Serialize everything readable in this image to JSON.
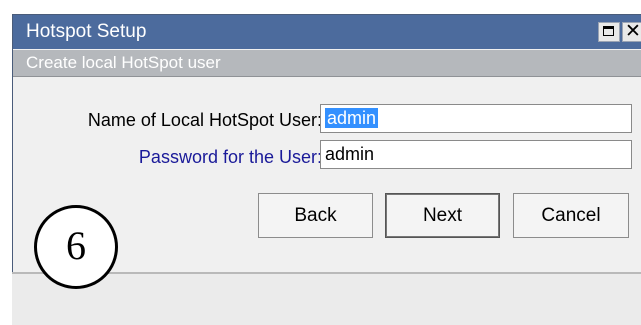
{
  "window": {
    "title": "Hotspot Setup",
    "subheader": "Create local HotSpot user",
    "controls": {
      "maximize_icon": "maximize-icon",
      "close_icon": "close-icon",
      "close_glyph": "✕"
    }
  },
  "form": {
    "name_label": "Name of Local HotSpot User:",
    "name_value": "admin",
    "password_label": "Password for the User:",
    "password_value": "admin"
  },
  "buttons": {
    "back": "Back",
    "next": "Next",
    "cancel": "Cancel"
  },
  "annotation": {
    "step_number": "6"
  },
  "colors": {
    "titlebar": "#4c6b9d",
    "subheader": "#b5b8bc",
    "selection": "#3390ff",
    "password_label": "#1a1a99"
  }
}
